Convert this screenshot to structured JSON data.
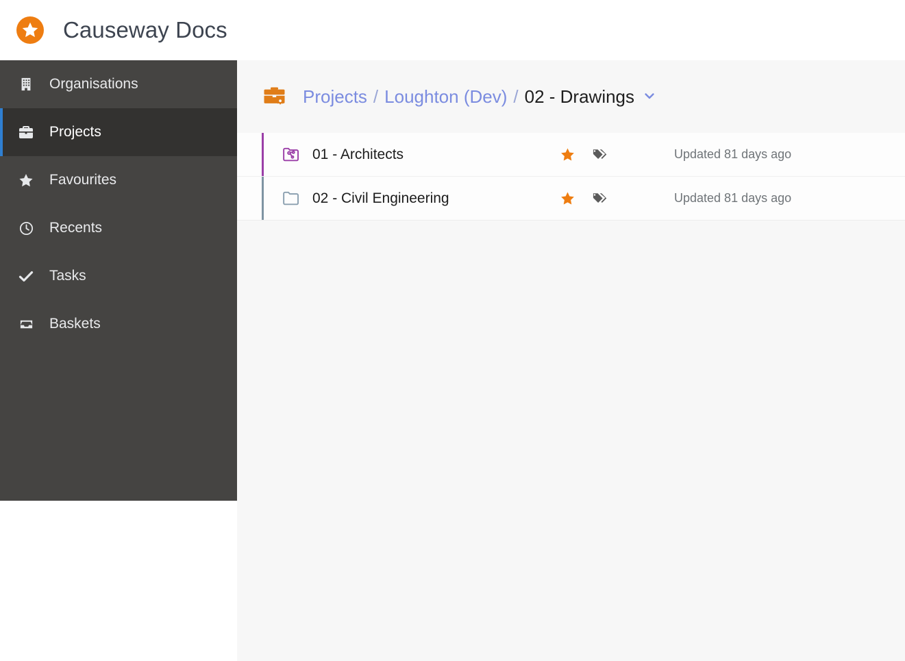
{
  "app": {
    "title": "Causeway Docs",
    "logo_icon": "star-badge-icon",
    "brand_color": "#ee7d11"
  },
  "sidebar": {
    "items": [
      {
        "label": "Organisations",
        "icon": "building-icon",
        "active": false
      },
      {
        "label": "Projects",
        "icon": "briefcase-icon",
        "active": true
      },
      {
        "label": "Favourites",
        "icon": "star-icon",
        "active": false
      },
      {
        "label": "Recents",
        "icon": "clock-icon",
        "active": false
      },
      {
        "label": "Tasks",
        "icon": "check-icon",
        "active": false
      },
      {
        "label": "Baskets",
        "icon": "inbox-icon",
        "active": false
      }
    ],
    "active_accent_color": "#2f7fd1",
    "background_color": "#454442"
  },
  "breadcrumb": {
    "icon": "project-briefcase-gear-icon",
    "crumbs": [
      {
        "label": "Projects",
        "is_link": true
      },
      {
        "label": "Loughton (Dev)",
        "is_link": true
      },
      {
        "label": "02 - Drawings",
        "is_link": false
      }
    ],
    "separator": "/",
    "caret_icon": "chevron-down-icon",
    "link_color": "#7b8ce0"
  },
  "list": {
    "rows": [
      {
        "name": "01 - Architects",
        "folder_icon": "shared-folder-icon",
        "accent_color": "#9b3fa8",
        "folder_color": "#9b3fa8",
        "favourite": true,
        "favourite_icon": "star-icon",
        "tag_icon": "tags-icon",
        "updated": "Updated 81 days ago"
      },
      {
        "name": "02 - Civil Engineering",
        "folder_icon": "folder-icon",
        "accent_color": "#7f94a3",
        "folder_color": "#8ba0b0",
        "favourite": true,
        "favourite_icon": "star-icon",
        "tag_icon": "tags-icon",
        "updated": "Updated 81 days ago"
      }
    ],
    "favourite_color": "#ee7d11",
    "tag_color": "#5b5b5b"
  }
}
